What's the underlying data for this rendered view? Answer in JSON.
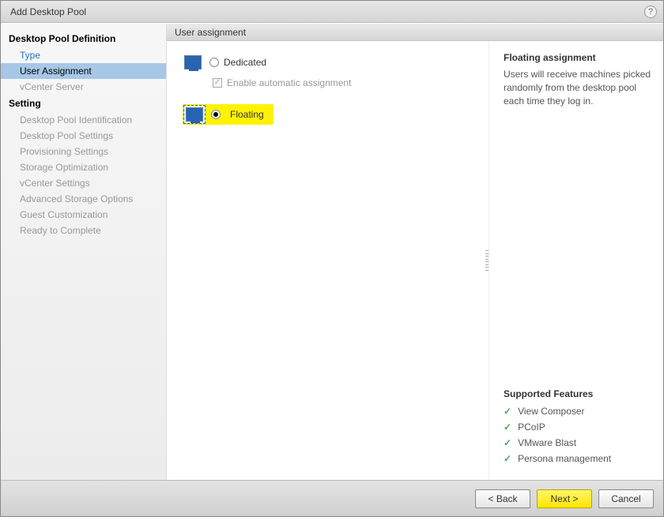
{
  "window_title": "Add Desktop Pool",
  "sidebar": {
    "group1_heading": "Desktop Pool Definition",
    "group1": [
      {
        "label": "Type",
        "state": "enabled"
      },
      {
        "label": "User Assignment",
        "state": "selected"
      },
      {
        "label": "vCenter Server",
        "state": "disabled"
      }
    ],
    "group2_heading": "Setting",
    "group2": [
      {
        "label": "Desktop Pool Identification"
      },
      {
        "label": "Desktop Pool Settings"
      },
      {
        "label": "Provisioning Settings"
      },
      {
        "label": "Storage Optimization"
      },
      {
        "label": "vCenter Settings"
      },
      {
        "label": "Advanced Storage Options"
      },
      {
        "label": "Guest Customization"
      },
      {
        "label": "Ready to Complete"
      }
    ]
  },
  "section_header": "User assignment",
  "options": {
    "dedicated_label": "Dedicated",
    "enable_auto_label": "Enable automatic assignment",
    "floating_label": "Floating"
  },
  "info_panel": {
    "title": "Floating assignment",
    "description": "Users will receive machines picked randomly from the desktop pool each time they log in.",
    "features_title": "Supported Features",
    "features": [
      "View Composer",
      "PCoIP",
      "VMware Blast",
      "Persona management"
    ]
  },
  "buttons": {
    "back": "< Back",
    "next": "Next >",
    "cancel": "Cancel"
  }
}
